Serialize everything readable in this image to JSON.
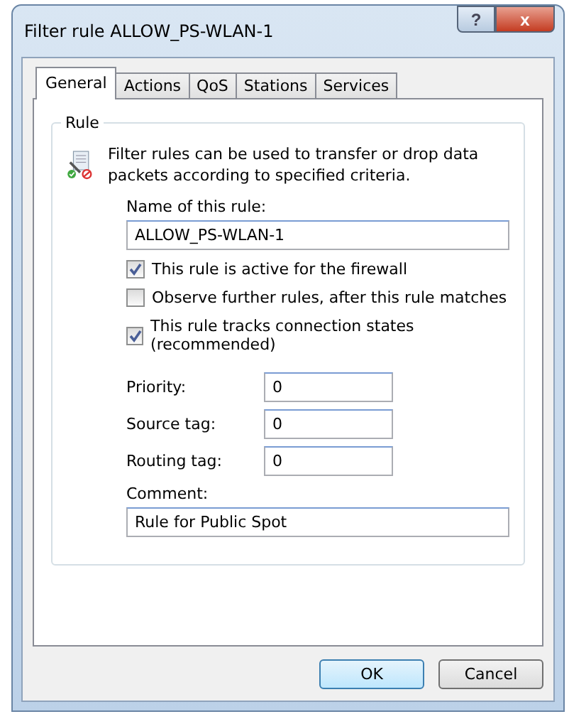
{
  "window": {
    "title": "Filter rule ALLOW_PS-WLAN-1",
    "help": "?",
    "close": "x"
  },
  "tabs": [
    {
      "label": "General",
      "selected": true
    },
    {
      "label": "Actions",
      "selected": false
    },
    {
      "label": "QoS",
      "selected": false
    },
    {
      "label": "Stations",
      "selected": false
    },
    {
      "label": "Services",
      "selected": false
    }
  ],
  "group": {
    "title": "Rule",
    "description": "Filter rules can be used to transfer or drop data packets according to specified criteria.",
    "name_label": "Name of this rule:",
    "name_value": "ALLOW_PS-WLAN-1",
    "options": [
      {
        "label": "This rule is active for the firewall",
        "checked": true
      },
      {
        "label": "Observe further rules, after this rule matches",
        "checked": false
      },
      {
        "label": "This rule tracks connection states (recommended)",
        "checked": true
      }
    ],
    "fields": [
      {
        "label": "Priority:",
        "value": "0"
      },
      {
        "label": "Source tag:",
        "value": "0"
      },
      {
        "label": "Routing tag:",
        "value": "0"
      }
    ],
    "comment_label": "Comment:",
    "comment_value": "Rule for Public Spot"
  },
  "buttons": [
    {
      "label": "OK",
      "selected": true
    },
    {
      "label": "Cancel",
      "selected": false
    }
  ]
}
